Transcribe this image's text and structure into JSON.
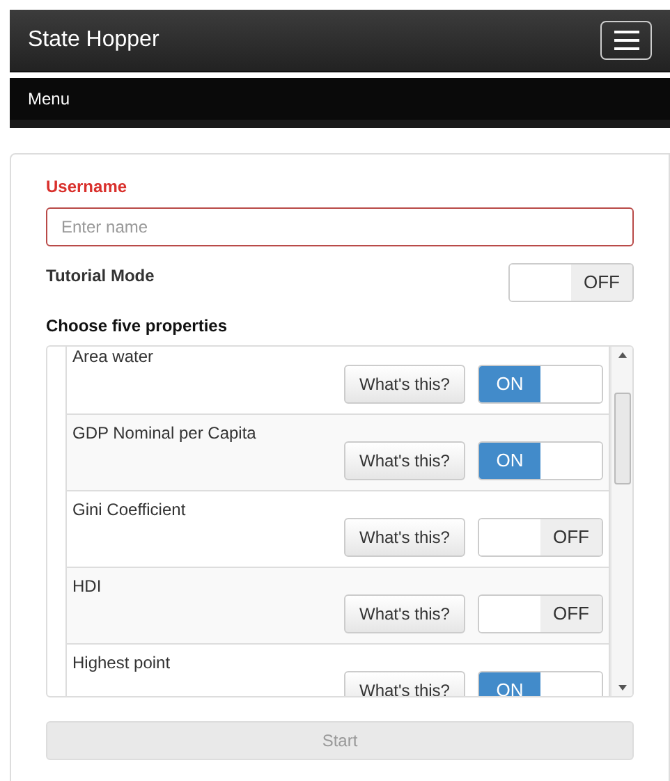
{
  "navbar": {
    "title": "State Hopper"
  },
  "menu_bar": {
    "label": "Menu"
  },
  "form": {
    "username": {
      "label": "Username",
      "placeholder": "Enter name"
    },
    "tutorial": {
      "label": "Tutorial Mode",
      "on": false,
      "state_text": "OFF"
    },
    "properties_label": "Choose five properties",
    "properties": [
      {
        "name": "Area water",
        "help": "What's this?",
        "on": true,
        "state_text": "ON"
      },
      {
        "name": "GDP Nominal per Capita",
        "help": "What's this?",
        "on": true,
        "state_text": "ON"
      },
      {
        "name": "Gini Coefficient",
        "help": "What's this?",
        "on": false,
        "state_text": "OFF"
      },
      {
        "name": "HDI",
        "help": "What's this?",
        "on": false,
        "state_text": "OFF"
      },
      {
        "name": "Highest point",
        "help": "What's this?",
        "on": true,
        "state_text": "ON"
      }
    ],
    "start": {
      "label": "Start",
      "disabled": true
    }
  }
}
